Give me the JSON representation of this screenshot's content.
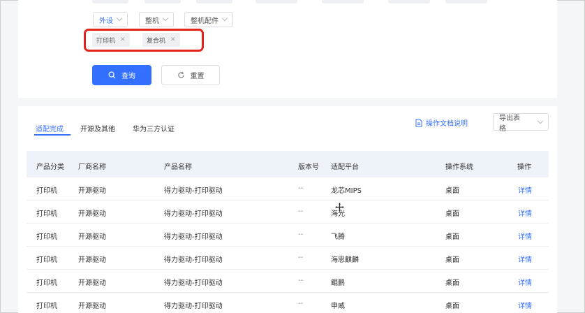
{
  "filters": {
    "selects": [
      {
        "label": "外设",
        "active": true
      },
      {
        "label": "整机",
        "active": false
      },
      {
        "label": "整机配件",
        "active": false
      }
    ],
    "tags": [
      "打印机",
      "复合机"
    ],
    "query_label": "查询",
    "reset_label": "重置"
  },
  "tabs": [
    "适配完成",
    "开源及其他",
    "华为三方认证"
  ],
  "doc_link": "操作文档说明",
  "export_label": "导出表格",
  "table": {
    "headers": [
      "产品分类",
      "厂商名称",
      "产品名称",
      "版本号",
      "适配平台",
      "操作系统",
      "操作"
    ],
    "rows": [
      [
        "打印机",
        "开源驱动",
        "得力驱动-打印驱动",
        "--",
        "龙芯MIPS",
        "桌面",
        "详情"
      ],
      [
        "打印机",
        "开源驱动",
        "得力驱动-打印驱动",
        "--",
        "海光",
        "桌面",
        "详情"
      ],
      [
        "打印机",
        "开源驱动",
        "得力驱动-打印驱动",
        "--",
        "飞腾",
        "桌面",
        "详情"
      ],
      [
        "打印机",
        "开源驱动",
        "得力驱动-打印驱动",
        "--",
        "海思麒麟",
        "桌面",
        "详情"
      ],
      [
        "打印机",
        "开源驱动",
        "得力驱动-打印驱动",
        "--",
        "鲲鹏",
        "桌面",
        "详情"
      ],
      [
        "打印机",
        "开源驱动",
        "得力驱动-打印驱动",
        "--",
        "申威",
        "桌面",
        "详情"
      ]
    ]
  },
  "colors": {
    "accent": "#3370ff",
    "highlight": "#e3241b"
  }
}
